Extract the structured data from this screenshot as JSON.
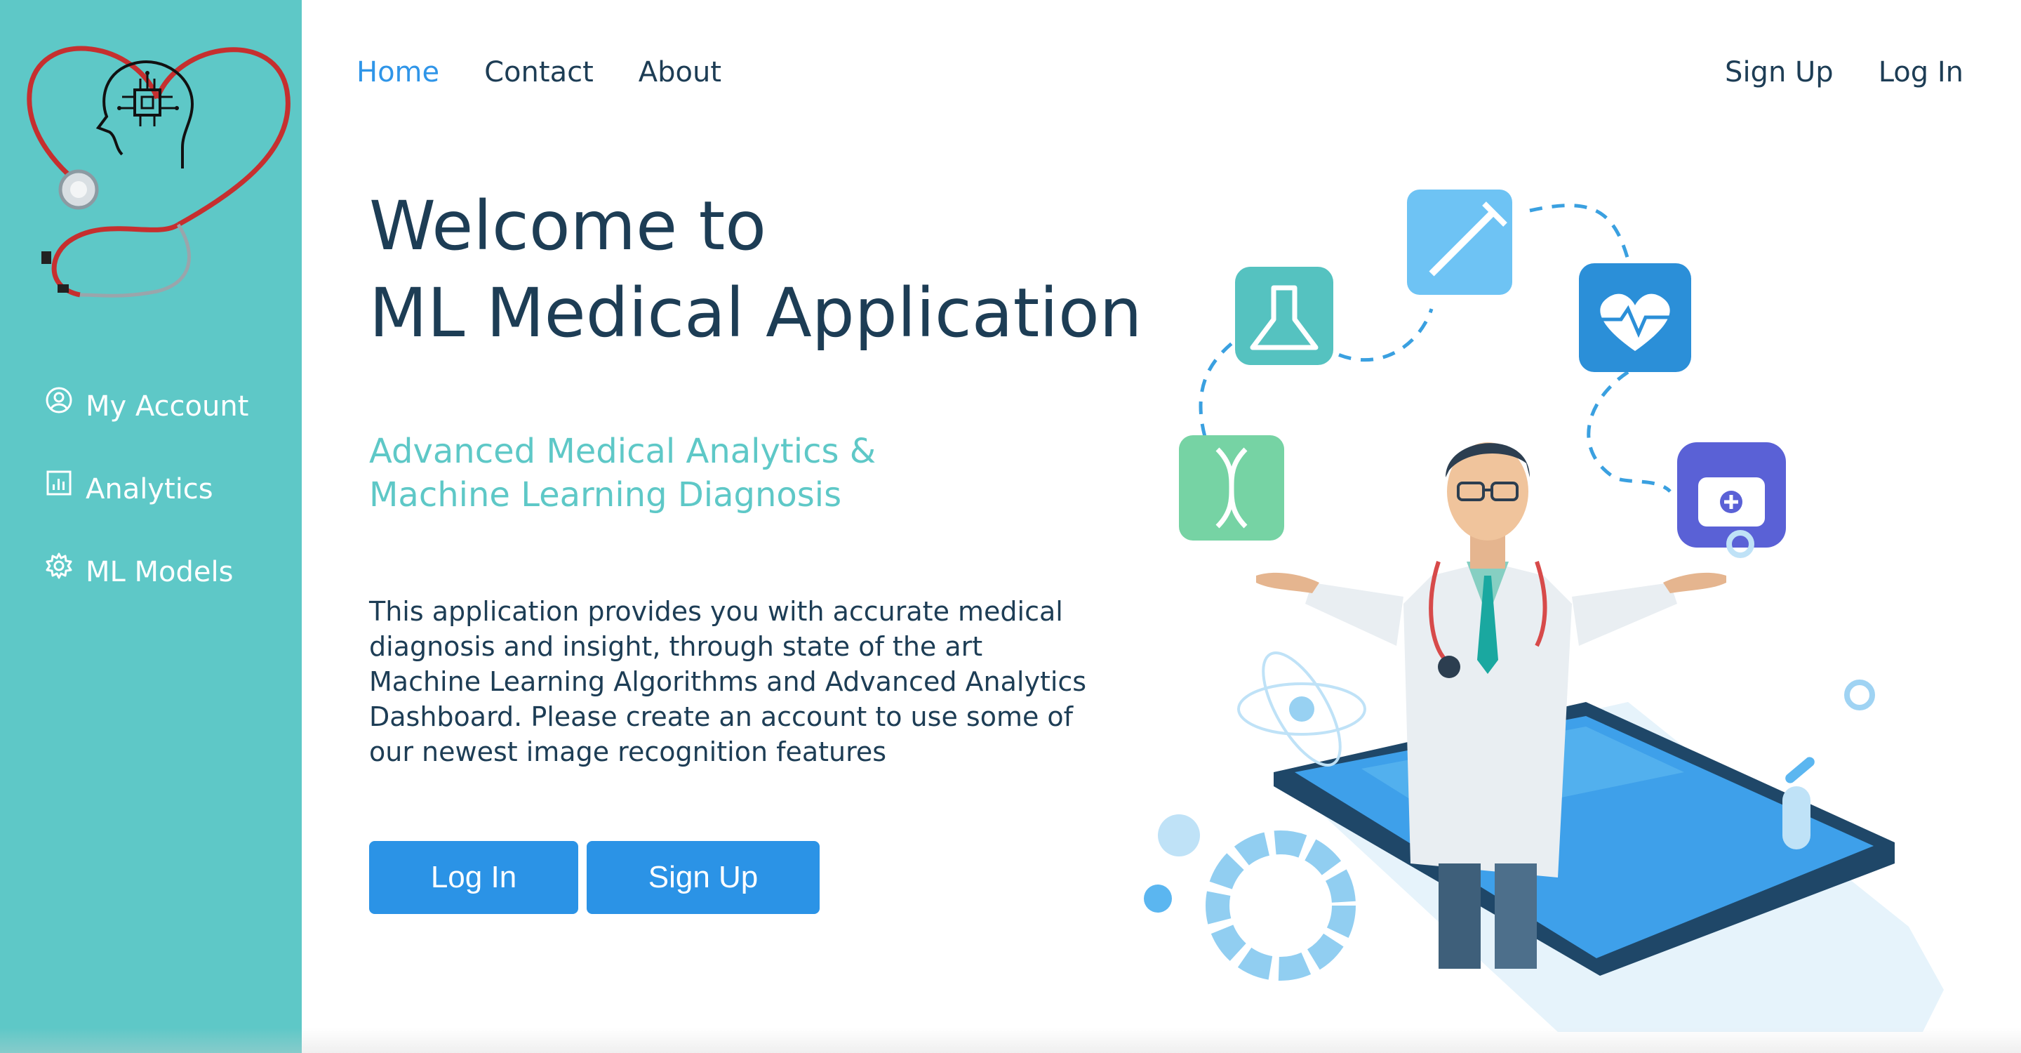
{
  "nav": {
    "home": "Home",
    "contact": "Contact",
    "about": "About",
    "signup": "Sign Up",
    "login": "Log In"
  },
  "sidebar": {
    "items": [
      {
        "label": "My Account",
        "icon": "user-circle-icon"
      },
      {
        "label": "Analytics",
        "icon": "bar-chart-icon"
      },
      {
        "label": "ML Models",
        "icon": "gear-icon"
      }
    ]
  },
  "hero": {
    "title_line1": "Welcome to",
    "title_line2": "ML Medical Application",
    "subtitle_line1": "Advanced Medical Analytics &",
    "subtitle_line2": "Machine Learning Diagnosis",
    "desc_lines": [
      "This application provides you with accurate medical",
      "diagnosis and insight, through state of the art",
      "Machine Learning Algorithms and Advanced Analytics",
      "Dashboard. Please create an account to use some of",
      "our newest image recognition features"
    ]
  },
  "buttons": {
    "login": "Log In",
    "signup": "Sign Up"
  },
  "colors": {
    "sidebar": "#5ec8c7",
    "accent": "#2b93e6",
    "active_link": "#2f95e8",
    "text": "#1d3d55",
    "subtitle": "#5ec8c7"
  }
}
